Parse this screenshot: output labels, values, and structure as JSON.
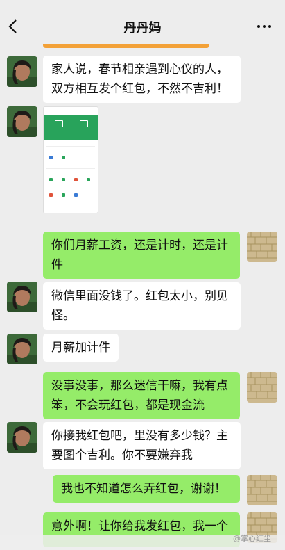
{
  "header": {
    "title": "丹丹妈"
  },
  "messages": [
    {
      "from": "contact",
      "text": "家人说，春节相亲遇到心仪的人，双方相互发个红包，不然不吉利！"
    },
    {
      "from": "contact",
      "type": "image",
      "description": "wechat-wallet-screenshot"
    },
    {
      "from": "me",
      "text": "你们月薪工资，还是计时，还是计件"
    },
    {
      "from": "contact",
      "text": "微信里面没钱了。红包太小，别见怪。"
    },
    {
      "from": "contact",
      "text": "月薪加计件"
    },
    {
      "from": "me",
      "text": "没事没事，那么迷信干嘛，我有点笨，不会玩红包，都是现金流"
    },
    {
      "from": "contact",
      "text": "你接我红包吧，里没有多少钱？主要图个吉利。你不要嫌弃我"
    },
    {
      "from": "me",
      "text": "我也不知道怎么弄红包，谢谢！"
    },
    {
      "from": "me",
      "text": "意外啊！让你给我发红包，我一个"
    }
  ],
  "watermark": "@掌心红尘",
  "colors": {
    "sent_bubble": "#95ec69",
    "received_bubble": "#ffffff",
    "background": "#ededed",
    "accent_bar": "#f3a137"
  }
}
